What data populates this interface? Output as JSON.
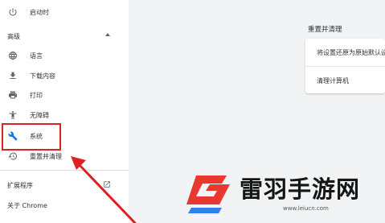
{
  "sidebar": {
    "top_item": {
      "label": "启动时",
      "icon": "power-icon"
    },
    "section_title": "高级",
    "items": [
      {
        "label": "语言",
        "icon": "globe-icon"
      },
      {
        "label": "下载内容",
        "icon": "download-icon"
      },
      {
        "label": "打印",
        "icon": "printer-icon"
      },
      {
        "label": "无障碍",
        "icon": "accessibility-icon"
      },
      {
        "label": "系统",
        "icon": "wrench-icon"
      },
      {
        "label": "重置并清理",
        "icon": "history-icon"
      }
    ],
    "extensions_label": "扩展程序",
    "about_label": "关于 Chrome"
  },
  "main": {
    "section_title": "重置并清理",
    "rows": [
      {
        "label": "将设置还原为原始默认设"
      },
      {
        "label": "清理计算机"
      }
    ]
  },
  "watermark": {
    "brand": "雷羽手游网",
    "url": "www.leiucn.com"
  },
  "colors": {
    "highlight": "#e02020",
    "arrow": "#e02020",
    "logo_red": "#e8382f",
    "logo_blue": "#2f80ed"
  }
}
